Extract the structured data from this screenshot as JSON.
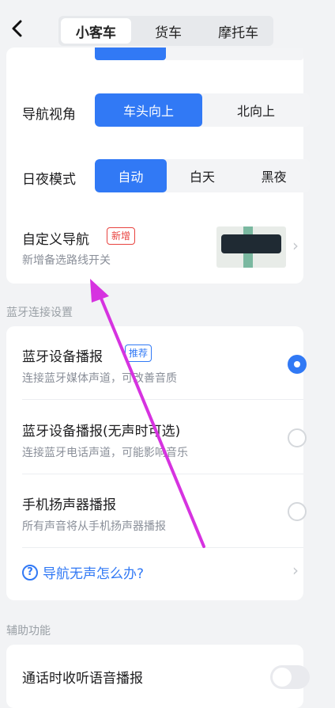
{
  "header": {
    "tabs": [
      {
        "label": "小客车",
        "active": true
      },
      {
        "label": "货车",
        "active": false
      },
      {
        "label": "摩托车",
        "active": false
      }
    ]
  },
  "display": {
    "nav_view": {
      "label": "导航视角",
      "options": [
        "车头向上",
        "北向上"
      ],
      "selected": "车头向上"
    },
    "day_night": {
      "label": "日夜模式",
      "options": [
        "自动",
        "白天",
        "黑夜"
      ],
      "selected": "自动"
    },
    "custom_nav": {
      "title": "自定义导航",
      "badge": "新增",
      "subtitle": "新增备选路线开关"
    }
  },
  "bluetooth": {
    "section_title": "蓝牙连接设置",
    "options": [
      {
        "title": "蓝牙设备播报",
        "badge": "推荐",
        "subtitle": "连接蓝牙媒体声道，可改善音质",
        "selected": true
      },
      {
        "title": "蓝牙设备播报(无声时可选)",
        "subtitle": "连接蓝牙电话声道，可能影响音乐",
        "selected": false
      },
      {
        "title": "手机扬声器播报",
        "subtitle": "所有声音将从手机扬声器播报",
        "selected": false
      }
    ],
    "help": {
      "icon": "?",
      "label": "导航无声怎么办?"
    }
  },
  "accessibility": {
    "section_title": "辅助功能",
    "call_broadcast": {
      "label": "通话时收听语音播报",
      "enabled": false
    }
  },
  "colors": {
    "accent": "#3179f5",
    "badge_red": "#e8433f",
    "annotation_arrow": "#d633e0"
  }
}
